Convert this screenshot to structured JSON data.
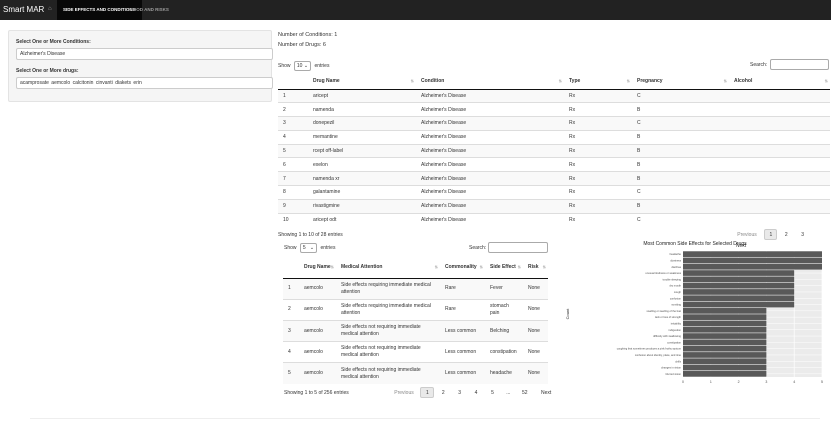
{
  "app": {
    "brand": "Smart MAR",
    "nav": [
      {
        "label": "SIDE EFFECTS AND CONDITIONS",
        "active": true
      },
      {
        "label": "FOOD AND RISKS",
        "active": false
      }
    ]
  },
  "sidebar": {
    "conditions_label": "Select One or More Conditions:",
    "conditions_value": "Alzheimer's Disease",
    "drugs_label": "Select One or More drugs:",
    "drugs": [
      "acamprosate",
      "aemcolo",
      "calcitonin",
      "cinvanti",
      "diakets",
      "erin"
    ]
  },
  "stats": {
    "conditions": "Number of Conditions: 1",
    "drugs": "Number of Drugs: 6"
  },
  "drug_table": {
    "show_label": "Show",
    "length": "10",
    "entries_label": "entries",
    "search_label": "Search:",
    "columns": [
      "",
      "Drug Name",
      "Condition",
      "Type",
      "Pregnancy",
      "Alcohol"
    ],
    "rows": [
      [
        "1",
        "aricept",
        "Alzheimer's Disease",
        "Rx",
        "C",
        ""
      ],
      [
        "2",
        "namenda",
        "Alzheimer's Disease",
        "Rx",
        "B",
        ""
      ],
      [
        "3",
        "donepezil",
        "Alzheimer's Disease",
        "Rx",
        "C",
        ""
      ],
      [
        "4",
        "memantine",
        "Alzheimer's Disease",
        "Rx",
        "B",
        ""
      ],
      [
        "5",
        "rcept off-label",
        "Alzheimer's Disease",
        "Rx",
        "B",
        ""
      ],
      [
        "6",
        "exelon",
        "Alzheimer's Disease",
        "Rx",
        "B",
        ""
      ],
      [
        "7",
        "namenda xr",
        "Alzheimer's Disease",
        "Rx",
        "B",
        ""
      ],
      [
        "8",
        "galantamine",
        "Alzheimer's Disease",
        "Rx",
        "C",
        ""
      ],
      [
        "9",
        "rivastigmine",
        "Alzheimer's Disease",
        "Rx",
        "B",
        ""
      ],
      [
        "10",
        "aricept odt",
        "Alzheimer's Disease",
        "Rx",
        "C",
        ""
      ]
    ],
    "info": "Showing 1 to 10 of 28 entries",
    "pager": [
      "Previous",
      "1",
      "2",
      "3",
      "Next"
    ]
  },
  "side_table": {
    "show_label": "Show",
    "length": "5",
    "entries_label": "entries",
    "search_label": "Search:",
    "columns": [
      "",
      "Drug Name",
      "Medical Attention",
      "Commonality",
      "Side Effect",
      "Risk"
    ],
    "rows": [
      [
        "1",
        "aemcolo",
        "Side effects requiring immediate medical attention",
        "Rare",
        "Fever",
        "None"
      ],
      [
        "2",
        "aemcolo",
        "Side effects requiring immediate medical attention",
        "Rare",
        "stomach pain",
        "None"
      ],
      [
        "3",
        "aemcolo",
        "Side effects not requiring immediate medical attention",
        "Less common",
        "Belching",
        "None"
      ],
      [
        "4",
        "aemcolo",
        "Side effects not requiring immediate medical attention",
        "Less common",
        "constipation",
        "None"
      ],
      [
        "5",
        "aemcolo",
        "Side effects not requiring immediate medical attention",
        "Less common",
        "headache",
        "None"
      ]
    ],
    "info": "Showing 1 to 5 of 256 entries",
    "pager": [
      "Previous",
      "1",
      "2",
      "3",
      "4",
      "5",
      "...",
      "52",
      "Next"
    ]
  },
  "chart_data": {
    "type": "bar",
    "orientation": "horizontal",
    "title": "Most Common Side Effects for Selected Drugs",
    "xlabel": "",
    "ylabel": "Count",
    "xlim": [
      0,
      5
    ],
    "xticks": [
      "0",
      "1",
      "2",
      "3",
      "4",
      "5"
    ],
    "grid": true,
    "bar_color": "#595959",
    "panel_color": "#ebebeb",
    "categories": [
      "headache",
      "dizziness",
      "diarrhea",
      "unusual tiredness or weakness",
      "trouble sleeping",
      "dry mouth",
      "cough",
      "confusion",
      "vomiting",
      "swelling or swelling of the feet",
      "lack or loss of strength",
      "irritability",
      "indigestion",
      "difficulty with swallowing",
      "constipation",
      "coughing that sometimes produces a pink frothy sputum",
      "confusion about identity, place, and time",
      "chills",
      "changes in vision",
      "blurred vision"
    ],
    "values": [
      5,
      5,
      5,
      4,
      4,
      4,
      4,
      4,
      4,
      3,
      3,
      3,
      3,
      3,
      3,
      3,
      3,
      3,
      3,
      3
    ]
  }
}
